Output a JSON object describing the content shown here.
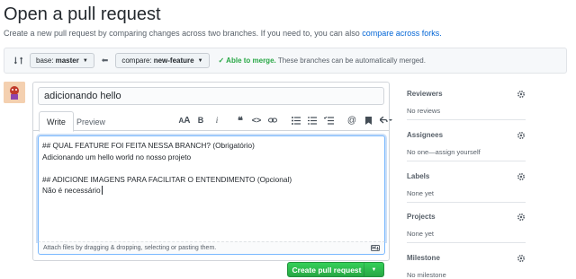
{
  "page": {
    "title": "Open a pull request",
    "subtitle_text": "Create a new pull request by comparing changes across two branches. If you need to, you can also",
    "subtitle_link": "compare across forks."
  },
  "compare": {
    "base_label": "base:",
    "base_branch": "master",
    "compare_label": "compare:",
    "compare_branch": "new-feature",
    "merge_status": "✓ Able to merge.",
    "merge_detail": "These branches can be automatically merged."
  },
  "editor": {
    "title_value": "adicionando hello",
    "tabs": [
      "Write",
      "Preview"
    ],
    "toolbar": {
      "heading": "AA",
      "bold": "B",
      "italic": "i",
      "quote": "❝",
      "code": "<>",
      "link": "link",
      "ul": "ul",
      "ol": "ol",
      "tasks": "tasks",
      "mention": "@",
      "reference": "ref",
      "reply": "reply"
    },
    "body_lines": [
      "## QUAL FEATURE FOI FEITA NESSA BRANCH? (Obrigatório)",
      "Adicionando um hello world no nosso projeto",
      "",
      "## ADICIONE IMAGENS PARA FACILITAR O ENTENDIMENTO (Opcional)",
      "Não é necessário"
    ],
    "attach_text": "Attach files by dragging & dropping, selecting or pasting them."
  },
  "submit": {
    "label": "Create pull request"
  },
  "sidebar": {
    "sections": [
      {
        "title": "Reviewers",
        "value": "No reviews"
      },
      {
        "title": "Assignees",
        "value": "No one—assign yourself"
      },
      {
        "title": "Labels",
        "value": "None yet"
      },
      {
        "title": "Projects",
        "value": "None yet"
      },
      {
        "title": "Milestone",
        "value": "No milestone"
      }
    ]
  },
  "colors": {
    "accent": "#0366d6",
    "success": "#28a745",
    "border": "#e1e4e8"
  }
}
